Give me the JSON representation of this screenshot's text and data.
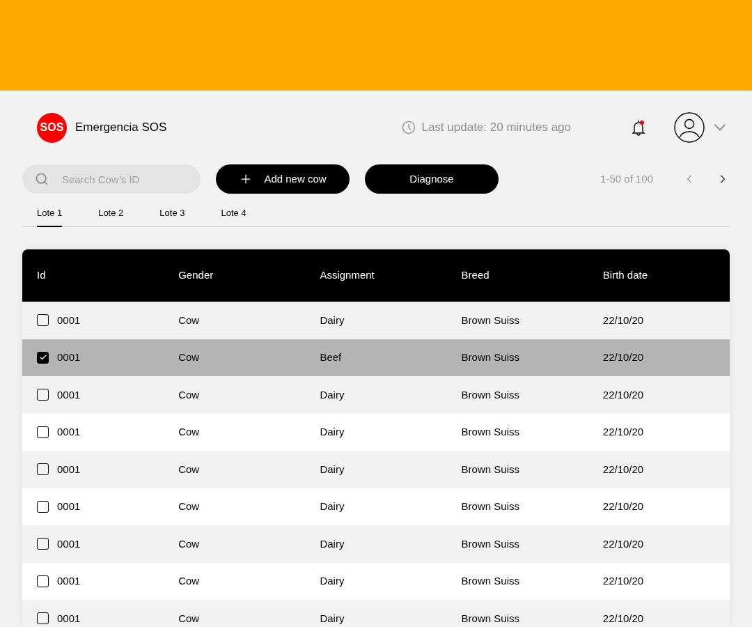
{
  "header": {
    "logo": "SOS",
    "title": "Emergencia SOS",
    "last_update": "Last update: 20 minutes ago",
    "notification_unread": true
  },
  "toolbar": {
    "search": {
      "placeholder": "Search Cow’s ID"
    },
    "buttons": [
      {
        "kind": "add",
        "label": "Add new cow"
      },
      {
        "kind": "plain",
        "label": "Diagnose"
      }
    ],
    "pagination": "1-50 of 100"
  },
  "tabs": [
    {
      "label": "Lote 1",
      "selected": true
    },
    {
      "label": "Lote 2",
      "selected": false
    },
    {
      "label": "Lote 3",
      "selected": false
    },
    {
      "label": "Lote 4",
      "selected": false
    }
  ],
  "table": {
    "columns": [
      "Id",
      "Gender",
      "Assignment",
      "Breed",
      "Birth date"
    ],
    "rows": [
      {
        "cells": [
          "0001",
          "Cow",
          "Dairy",
          "Brown Suiss",
          "22/10/20"
        ],
        "checked": false
      },
      {
        "cells": [
          "0001",
          "Cow",
          "Beef",
          "Brown Suiss",
          "22/10/20"
        ],
        "checked": true
      },
      {
        "cells": [
          "0001",
          "Cow",
          "Dairy",
          "Brown Suiss",
          "22/10/20"
        ],
        "checked": false
      },
      {
        "cells": [
          "0001",
          "Cow",
          "Dairy",
          "Brown Suiss",
          "22/10/20"
        ],
        "checked": false
      },
      {
        "cells": [
          "0001",
          "Cow",
          "Dairy",
          "Brown Suiss",
          "22/10/20"
        ],
        "checked": false
      },
      {
        "cells": [
          "0001",
          "Cow",
          "Dairy",
          "Brown Suiss",
          "22/10/20"
        ],
        "checked": false
      },
      {
        "cells": [
          "0001",
          "Cow",
          "Dairy",
          "Brown Suiss",
          "22/10/20"
        ],
        "checked": false
      },
      {
        "cells": [
          "0001",
          "Cow",
          "Dairy",
          "Brown Suiss",
          "22/10/20"
        ],
        "checked": false
      },
      {
        "cells": [
          "0001",
          "Cow",
          "Dairy",
          "Brown Suiss",
          "22/10/20"
        ],
        "checked": false
      }
    ]
  }
}
